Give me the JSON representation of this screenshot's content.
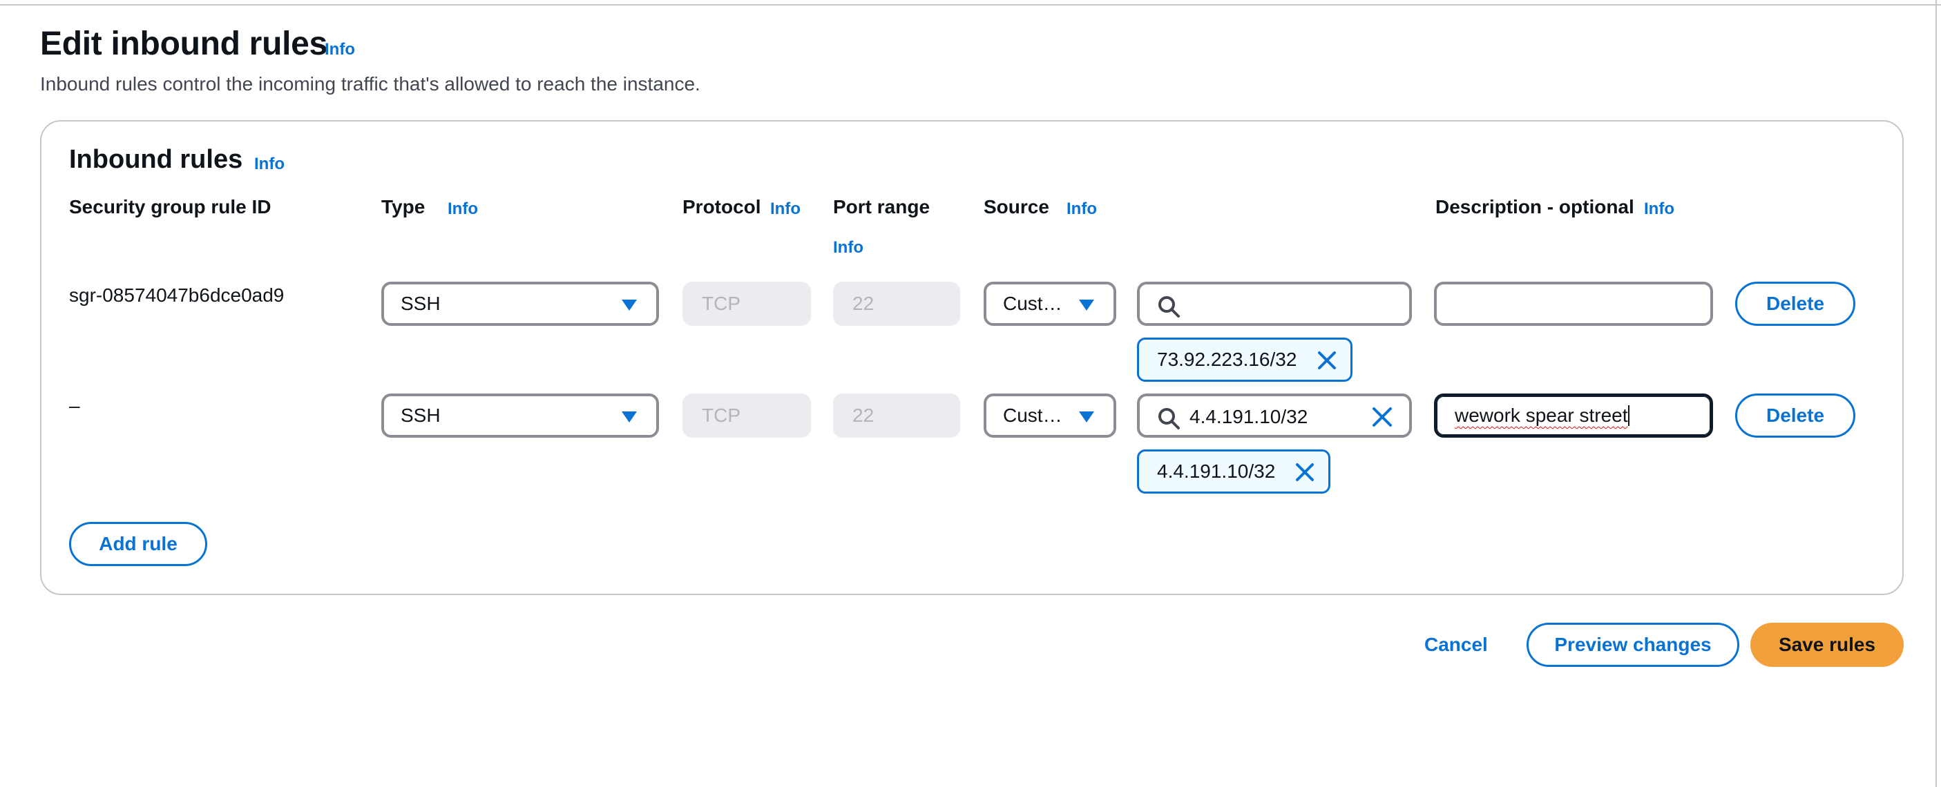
{
  "page": {
    "title": "Edit inbound rules",
    "title_info": "Info",
    "description": "Inbound rules control the incoming traffic that's allowed to reach the instance."
  },
  "section": {
    "title": "Inbound rules",
    "info": "Info"
  },
  "columns": {
    "rule_id": "Security group rule ID",
    "type": "Type",
    "type_info": "Info",
    "protocol": "Protocol",
    "protocol_info": "Info",
    "port_range": "Port range",
    "port_range_info": "Info",
    "source": "Source",
    "source_info": "Info",
    "description": "Description - optional",
    "description_info": "Info"
  },
  "rules": [
    {
      "rule_id": "sgr-08574047b6dce0ad9",
      "type": "SSH",
      "protocol": "TCP",
      "port_range": "22",
      "source": "Cust…",
      "search_value": "",
      "token": "73.92.223.16/32",
      "description": "",
      "delete_label": "Delete"
    },
    {
      "rule_id": "–",
      "type": "SSH",
      "protocol": "TCP",
      "port_range": "22",
      "source": "Cust…",
      "search_value": "4.4.191.10/32",
      "token": "4.4.191.10/32",
      "description": "wework spear street",
      "delete_label": "Delete"
    }
  ],
  "add_rule_label": "Add rule",
  "footer": {
    "cancel_label": "Cancel",
    "preview_label": "Preview changes",
    "save_label": "Save rules"
  },
  "colors": {
    "accent": "#0972d3",
    "primary_button": "#f2a03b",
    "border": "#8c8c94",
    "disabled_bg": "#ebebf0"
  },
  "icons": [
    "search-icon",
    "clear-icon",
    "caret-down-icon",
    "remove-token-icon"
  ]
}
